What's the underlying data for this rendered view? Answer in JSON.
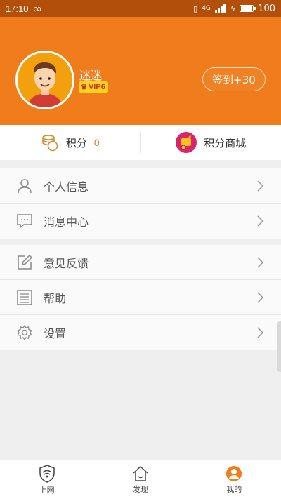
{
  "statusbar": {
    "time": "17:10",
    "network": "4G",
    "battery": "100"
  },
  "profile": {
    "username": "迷迷",
    "vip": "VIP6",
    "checkin_label": "签到+30"
  },
  "points": {
    "label": "积分",
    "value": "0",
    "mall_label": "积分商城"
  },
  "menu_group1": [
    {
      "label": "个人信息",
      "icon": "person-icon"
    },
    {
      "label": "消息中心",
      "icon": "message-icon"
    }
  ],
  "menu_group2": [
    {
      "label": "意见反馈",
      "icon": "edit-icon"
    },
    {
      "label": "帮助",
      "icon": "help-list-icon"
    },
    {
      "label": "设置",
      "icon": "gear-icon"
    }
  ],
  "tabbar": [
    {
      "label": "上网",
      "icon": "wifi-shield-icon"
    },
    {
      "label": "发现",
      "icon": "home-icon"
    },
    {
      "label": "我的",
      "icon": "profile-icon",
      "active": true
    }
  ],
  "colors": {
    "accent": "#f07c1b",
    "statusbar": "#b24f0a",
    "vip_bg": "#ffd21f"
  }
}
